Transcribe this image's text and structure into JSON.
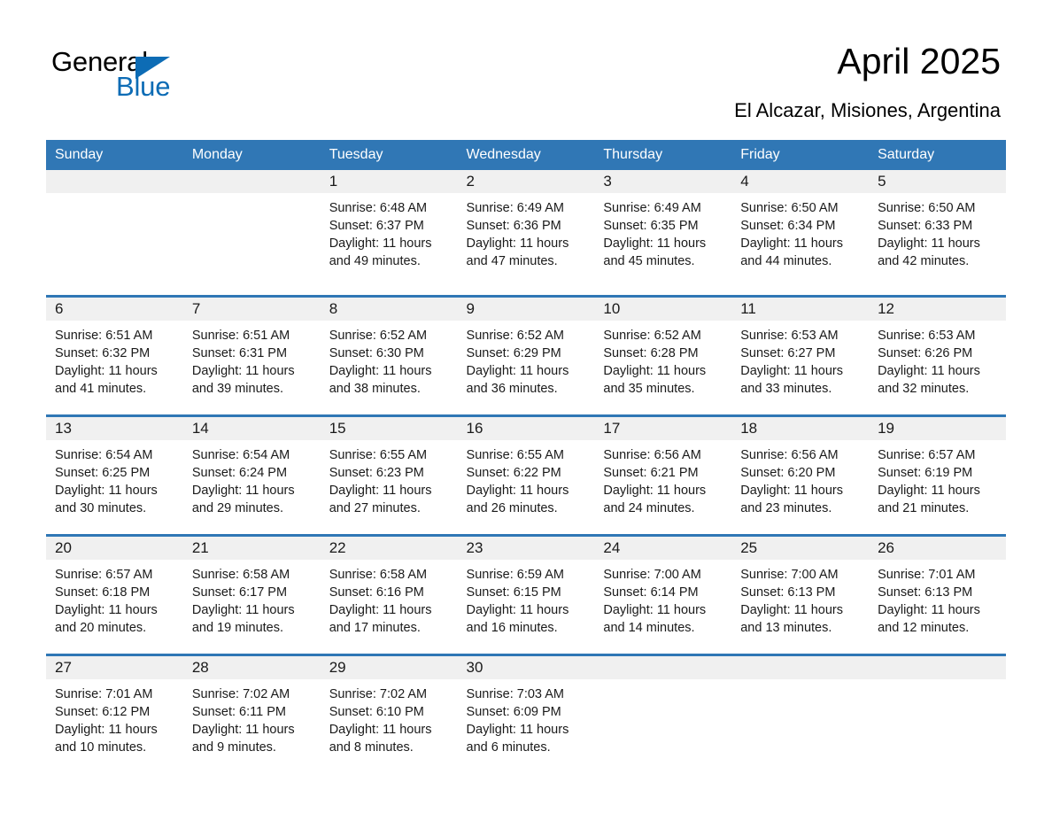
{
  "brand": {
    "name_part1": "General",
    "name_part2": "Blue"
  },
  "header": {
    "title": "April 2025",
    "subtitle": "El Alcazar, Misiones, Argentina"
  },
  "calendar": {
    "weekday_headers": [
      "Sunday",
      "Monday",
      "Tuesday",
      "Wednesday",
      "Thursday",
      "Friday",
      "Saturday"
    ],
    "colors": {
      "header_blue": "#3077b5",
      "separator_blue": "#2f77b5",
      "date_band": "#f0f0f0",
      "brand_blue": "#0d6cb5"
    },
    "weeks": [
      [
        {
          "date": "",
          "blank": true
        },
        {
          "date": "",
          "blank": true
        },
        {
          "date": "1",
          "sunrise": "Sunrise: 6:48 AM",
          "sunset": "Sunset: 6:37 PM",
          "daylight1": "Daylight: 11 hours",
          "daylight2": "and 49 minutes."
        },
        {
          "date": "2",
          "sunrise": "Sunrise: 6:49 AM",
          "sunset": "Sunset: 6:36 PM",
          "daylight1": "Daylight: 11 hours",
          "daylight2": "and 47 minutes."
        },
        {
          "date": "3",
          "sunrise": "Sunrise: 6:49 AM",
          "sunset": "Sunset: 6:35 PM",
          "daylight1": "Daylight: 11 hours",
          "daylight2": "and 45 minutes."
        },
        {
          "date": "4",
          "sunrise": "Sunrise: 6:50 AM",
          "sunset": "Sunset: 6:34 PM",
          "daylight1": "Daylight: 11 hours",
          "daylight2": "and 44 minutes."
        },
        {
          "date": "5",
          "sunrise": "Sunrise: 6:50 AM",
          "sunset": "Sunset: 6:33 PM",
          "daylight1": "Daylight: 11 hours",
          "daylight2": "and 42 minutes."
        }
      ],
      [
        {
          "date": "6",
          "sunrise": "Sunrise: 6:51 AM",
          "sunset": "Sunset: 6:32 PM",
          "daylight1": "Daylight: 11 hours",
          "daylight2": "and 41 minutes."
        },
        {
          "date": "7",
          "sunrise": "Sunrise: 6:51 AM",
          "sunset": "Sunset: 6:31 PM",
          "daylight1": "Daylight: 11 hours",
          "daylight2": "and 39 minutes."
        },
        {
          "date": "8",
          "sunrise": "Sunrise: 6:52 AM",
          "sunset": "Sunset: 6:30 PM",
          "daylight1": "Daylight: 11 hours",
          "daylight2": "and 38 minutes."
        },
        {
          "date": "9",
          "sunrise": "Sunrise: 6:52 AM",
          "sunset": "Sunset: 6:29 PM",
          "daylight1": "Daylight: 11 hours",
          "daylight2": "and 36 minutes."
        },
        {
          "date": "10",
          "sunrise": "Sunrise: 6:52 AM",
          "sunset": "Sunset: 6:28 PM",
          "daylight1": "Daylight: 11 hours",
          "daylight2": "and 35 minutes."
        },
        {
          "date": "11",
          "sunrise": "Sunrise: 6:53 AM",
          "sunset": "Sunset: 6:27 PM",
          "daylight1": "Daylight: 11 hours",
          "daylight2": "and 33 minutes."
        },
        {
          "date": "12",
          "sunrise": "Sunrise: 6:53 AM",
          "sunset": "Sunset: 6:26 PM",
          "daylight1": "Daylight: 11 hours",
          "daylight2": "and 32 minutes."
        }
      ],
      [
        {
          "date": "13",
          "sunrise": "Sunrise: 6:54 AM",
          "sunset": "Sunset: 6:25 PM",
          "daylight1": "Daylight: 11 hours",
          "daylight2": "and 30 minutes."
        },
        {
          "date": "14",
          "sunrise": "Sunrise: 6:54 AM",
          "sunset": "Sunset: 6:24 PM",
          "daylight1": "Daylight: 11 hours",
          "daylight2": "and 29 minutes."
        },
        {
          "date": "15",
          "sunrise": "Sunrise: 6:55 AM",
          "sunset": "Sunset: 6:23 PM",
          "daylight1": "Daylight: 11 hours",
          "daylight2": "and 27 minutes."
        },
        {
          "date": "16",
          "sunrise": "Sunrise: 6:55 AM",
          "sunset": "Sunset: 6:22 PM",
          "daylight1": "Daylight: 11 hours",
          "daylight2": "and 26 minutes."
        },
        {
          "date": "17",
          "sunrise": "Sunrise: 6:56 AM",
          "sunset": "Sunset: 6:21 PM",
          "daylight1": "Daylight: 11 hours",
          "daylight2": "and 24 minutes."
        },
        {
          "date": "18",
          "sunrise": "Sunrise: 6:56 AM",
          "sunset": "Sunset: 6:20 PM",
          "daylight1": "Daylight: 11 hours",
          "daylight2": "and 23 minutes."
        },
        {
          "date": "19",
          "sunrise": "Sunrise: 6:57 AM",
          "sunset": "Sunset: 6:19 PM",
          "daylight1": "Daylight: 11 hours",
          "daylight2": "and 21 minutes."
        }
      ],
      [
        {
          "date": "20",
          "sunrise": "Sunrise: 6:57 AM",
          "sunset": "Sunset: 6:18 PM",
          "daylight1": "Daylight: 11 hours",
          "daylight2": "and 20 minutes."
        },
        {
          "date": "21",
          "sunrise": "Sunrise: 6:58 AM",
          "sunset": "Sunset: 6:17 PM",
          "daylight1": "Daylight: 11 hours",
          "daylight2": "and 19 minutes."
        },
        {
          "date": "22",
          "sunrise": "Sunrise: 6:58 AM",
          "sunset": "Sunset: 6:16 PM",
          "daylight1": "Daylight: 11 hours",
          "daylight2": "and 17 minutes."
        },
        {
          "date": "23",
          "sunrise": "Sunrise: 6:59 AM",
          "sunset": "Sunset: 6:15 PM",
          "daylight1": "Daylight: 11 hours",
          "daylight2": "and 16 minutes."
        },
        {
          "date": "24",
          "sunrise": "Sunrise: 7:00 AM",
          "sunset": "Sunset: 6:14 PM",
          "daylight1": "Daylight: 11 hours",
          "daylight2": "and 14 minutes."
        },
        {
          "date": "25",
          "sunrise": "Sunrise: 7:00 AM",
          "sunset": "Sunset: 6:13 PM",
          "daylight1": "Daylight: 11 hours",
          "daylight2": "and 13 minutes."
        },
        {
          "date": "26",
          "sunrise": "Sunrise: 7:01 AM",
          "sunset": "Sunset: 6:13 PM",
          "daylight1": "Daylight: 11 hours",
          "daylight2": "and 12 minutes."
        }
      ],
      [
        {
          "date": "27",
          "sunrise": "Sunrise: 7:01 AM",
          "sunset": "Sunset: 6:12 PM",
          "daylight1": "Daylight: 11 hours",
          "daylight2": "and 10 minutes."
        },
        {
          "date": "28",
          "sunrise": "Sunrise: 7:02 AM",
          "sunset": "Sunset: 6:11 PM",
          "daylight1": "Daylight: 11 hours",
          "daylight2": "and 9 minutes."
        },
        {
          "date": "29",
          "sunrise": "Sunrise: 7:02 AM",
          "sunset": "Sunset: 6:10 PM",
          "daylight1": "Daylight: 11 hours",
          "daylight2": "and 8 minutes."
        },
        {
          "date": "30",
          "sunrise": "Sunrise: 7:03 AM",
          "sunset": "Sunset: 6:09 PM",
          "daylight1": "Daylight: 11 hours",
          "daylight2": "and 6 minutes."
        },
        {
          "date": "",
          "blank": true
        },
        {
          "date": "",
          "blank": true
        },
        {
          "date": "",
          "blank": true
        }
      ]
    ]
  }
}
